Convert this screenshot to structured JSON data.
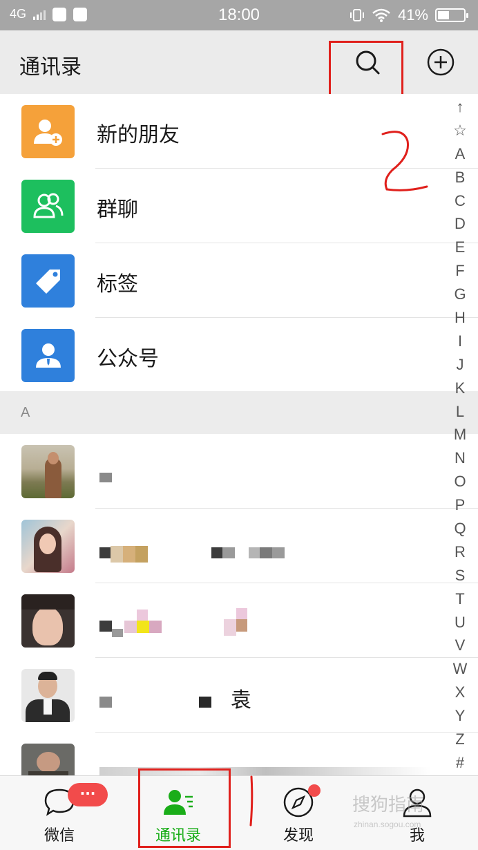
{
  "status_bar": {
    "network": "4G",
    "time": "18:00",
    "battery": "41%"
  },
  "header": {
    "title": "通讯录",
    "search_icon": "search-icon",
    "add_icon": "add-circle-icon"
  },
  "menu": [
    {
      "label": "新的朋友",
      "icon": "add-friend-icon",
      "color": "#f5a13a"
    },
    {
      "label": "群聊",
      "icon": "group-chat-icon",
      "color": "#1dbf5e"
    },
    {
      "label": "标签",
      "icon": "tag-icon",
      "color": "#2f80dc"
    },
    {
      "label": "公众号",
      "icon": "official-account-icon",
      "color": "#2f80dc"
    }
  ],
  "section": {
    "letter": "A"
  },
  "contacts": [
    {
      "name": ""
    },
    {
      "name": ""
    },
    {
      "name": ""
    },
    {
      "name": "袁"
    },
    {
      "name": ""
    }
  ],
  "index_letters": [
    "↑",
    "☆",
    "A",
    "B",
    "C",
    "D",
    "E",
    "F",
    "G",
    "H",
    "I",
    "J",
    "K",
    "L",
    "M",
    "N",
    "O",
    "P",
    "Q",
    "R",
    "S",
    "T",
    "U",
    "V",
    "W",
    "X",
    "Y",
    "Z",
    "#"
  ],
  "annotation": {
    "number": "2"
  },
  "tabs": [
    {
      "label": "微信",
      "icon": "chat-bubble-icon",
      "badge": "···"
    },
    {
      "label": "通讯录",
      "icon": "contacts-icon",
      "active": true
    },
    {
      "label": "发现",
      "icon": "compass-icon"
    },
    {
      "label": "我",
      "icon": "person-icon"
    }
  ],
  "watermark": {
    "text": "搜狗指南",
    "sub": "zhinan.sogou.com"
  },
  "colors": {
    "accent_green": "#1aad19",
    "header_bg": "#ebebeb",
    "annotation_red": "#e0201c",
    "badge_red": "#f24b4b"
  }
}
